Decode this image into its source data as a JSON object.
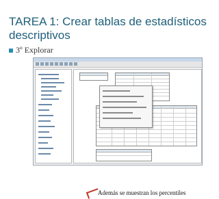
{
  "slide": {
    "title": "TAREA 1: Crear tablas de estadísticos descriptivos",
    "bullet": "3º Explorar"
  },
  "screenshot": {
    "caption": "Además se muestran los percentiles"
  }
}
